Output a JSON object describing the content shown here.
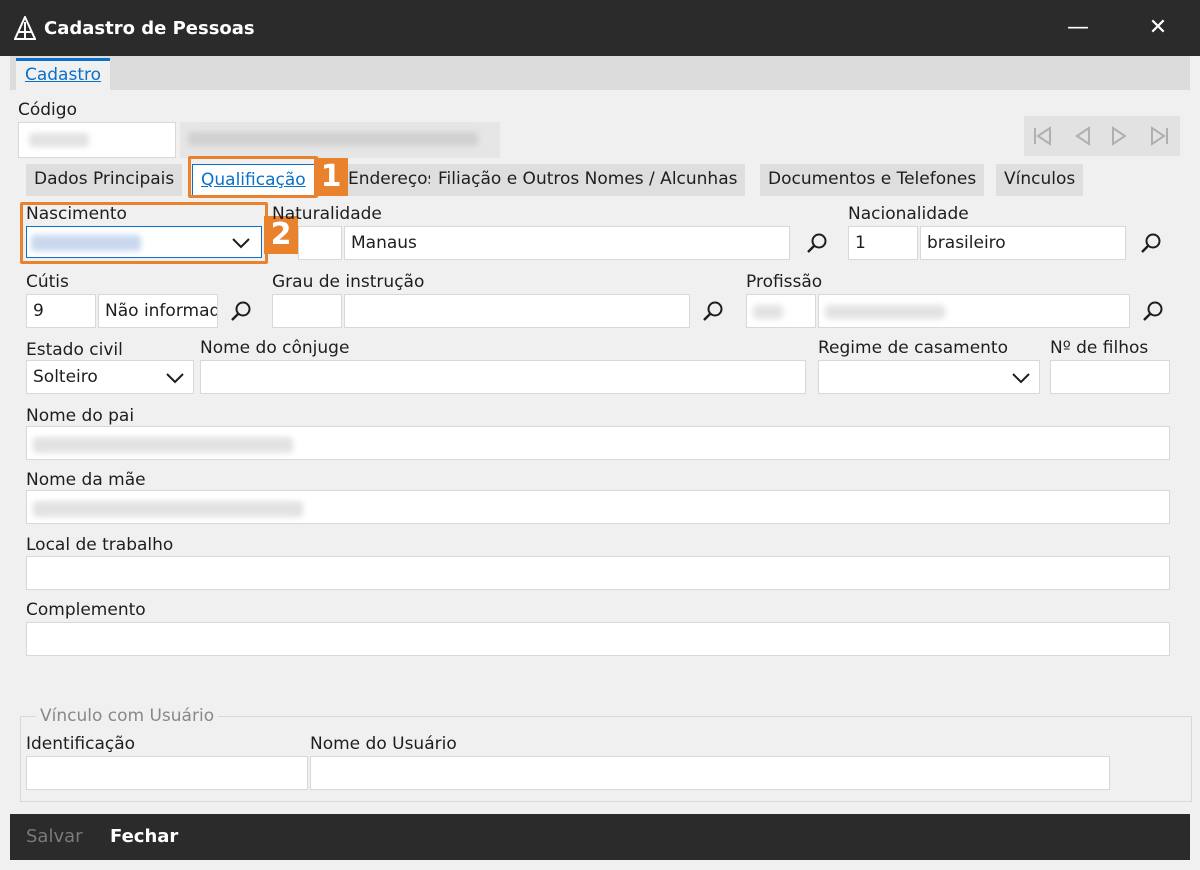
{
  "window": {
    "title": "Cadastro de Pessoas",
    "minimize": "—",
    "close": "✕"
  },
  "outer_tab": {
    "label": "Cadastro"
  },
  "codigo": {
    "label": "Código"
  },
  "tabs": [
    {
      "label": "Dados Principais"
    },
    {
      "label": "Qualificação"
    },
    {
      "label": "Endereços"
    },
    {
      "label": "Filiação e Outros Nomes / Alcunhas"
    },
    {
      "label": "Documentos e Telefones"
    },
    {
      "label": "Vínculos"
    }
  ],
  "callouts": {
    "one": "1",
    "two": "2"
  },
  "form": {
    "nascimento": {
      "label": "Nascimento"
    },
    "naturalidade": {
      "label": "Naturalidade",
      "value": "Manaus"
    },
    "nacionalidade": {
      "label": "Nacionalidade",
      "code": "1",
      "value": "brasileiro"
    },
    "cutis": {
      "label": "Cútis",
      "code": "9",
      "value": "Não informado"
    },
    "grau": {
      "label": "Grau de instrução"
    },
    "profissao": {
      "label": "Profissão"
    },
    "estado_civil": {
      "label": "Estado civil",
      "value": "Solteiro"
    },
    "conjuge": {
      "label": "Nome do cônjuge"
    },
    "regime": {
      "label": "Regime de casamento"
    },
    "filhos": {
      "label": "Nº de filhos"
    },
    "pai": {
      "label": "Nome do pai"
    },
    "mae": {
      "label": "Nome da mãe"
    },
    "trabalho": {
      "label": "Local de trabalho"
    },
    "complemento": {
      "label": "Complemento"
    }
  },
  "vinculo": {
    "title": "Vínculo com Usuário",
    "identificacao": {
      "label": "Identificação"
    },
    "nome_usuario": {
      "label": "Nome do Usuário"
    }
  },
  "footer": {
    "save": "Salvar",
    "close": "Fechar"
  }
}
